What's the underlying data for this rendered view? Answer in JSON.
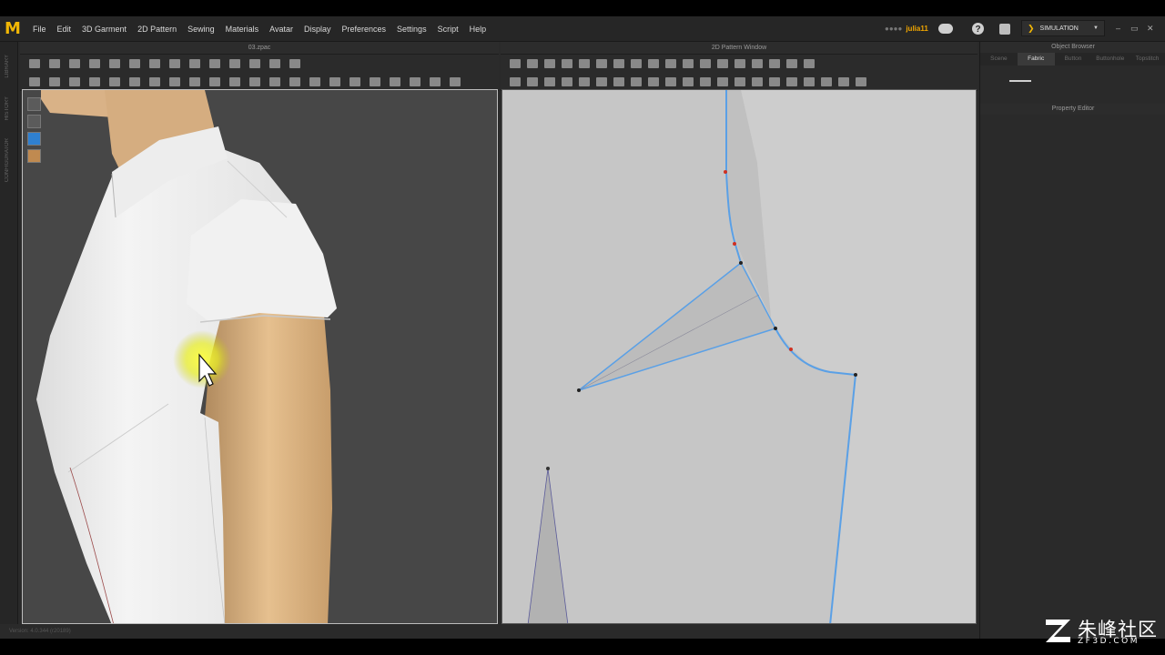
{
  "menubar": {
    "logo": "M",
    "items": [
      "File",
      "Edit",
      "3D Garment",
      "2D Pattern",
      "Sewing",
      "Materials",
      "Avatar",
      "Display",
      "Preferences",
      "Settings",
      "Script",
      "Help"
    ],
    "user_prefix": "●●●●",
    "username": "julia11",
    "help_glyph": "?",
    "mode_label": "SIMULATION",
    "mode_glyph": "❯",
    "dropdown_glyph": "▼",
    "window_controls": [
      "–",
      "▭",
      "✕"
    ]
  },
  "left_strip": {
    "labels": [
      "LIBRARY",
      "HISTORY",
      "CONFIGURATOR"
    ]
  },
  "panels": {
    "view3d_title": "03.zpac",
    "view2d_title": "2D Pattern Window"
  },
  "right_panel": {
    "object_browser": "Object Browser",
    "tabs": [
      "Scene",
      "Fabric",
      "Button",
      "Buttonhole",
      "Topstitch"
    ],
    "active_tab": 1,
    "property_editor": "Property Editor"
  },
  "status": {
    "text": "Version: 4.0.344    (r20189)"
  },
  "watermark": {
    "chinese": "朱峰社区",
    "domain": "ZF3D.COM"
  },
  "colors": {
    "accent": "#f2b705",
    "pattern_outline": "#5aa0e6",
    "point_red": "#d03020",
    "pattern_bg": "#c6c6c6",
    "viewport_bg": "#474747"
  },
  "icons": {
    "cursor": "arrow-cursor-icon",
    "highlight": "click-highlight-icon"
  }
}
